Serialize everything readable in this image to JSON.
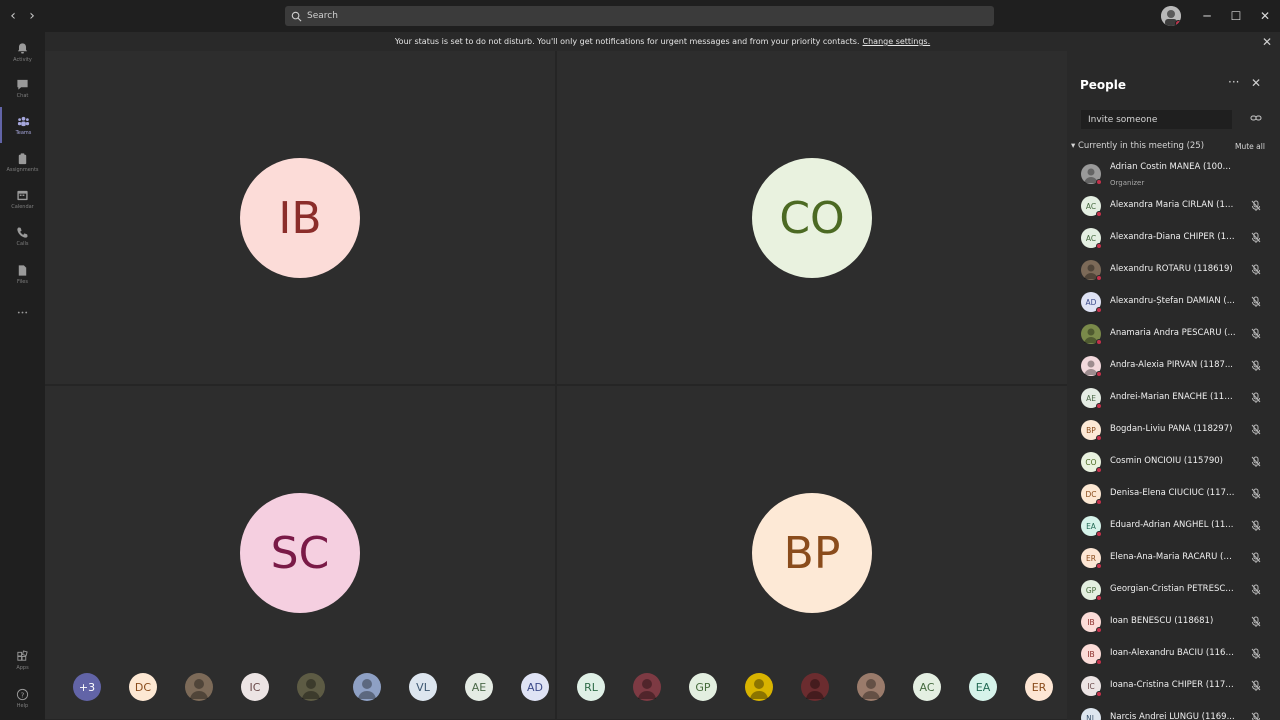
{
  "titlebar": {
    "search_placeholder": "Search",
    "back": "‹",
    "forward": "›",
    "minimize": "─",
    "maximize": "☐",
    "close": "✕"
  },
  "appbar": {
    "items": [
      {
        "label": "Activity",
        "icon": "bell-icon"
      },
      {
        "label": "Chat",
        "icon": "chat-icon"
      },
      {
        "label": "Teams",
        "icon": "teams-icon",
        "active": true
      },
      {
        "label": "Assignments",
        "icon": "assignments-icon"
      },
      {
        "label": "Calendar",
        "icon": "calendar-icon"
      },
      {
        "label": "Calls",
        "icon": "phone-icon"
      },
      {
        "label": "Files",
        "icon": "files-icon"
      },
      {
        "label": "",
        "icon": "more-icon"
      }
    ],
    "bottom": [
      {
        "label": "Apps",
        "icon": "apps-icon"
      },
      {
        "label": "Help",
        "icon": "help-icon"
      }
    ]
  },
  "notification": {
    "text": "Your status is set to do not disturb. You'll only get notifications for urgent messages and from your priority contacts.",
    "link": "Change settings."
  },
  "stage": {
    "tiles": [
      {
        "initials": "IB",
        "bg": "#fcdcd8",
        "fg": "#8b2d2a"
      },
      {
        "initials": "CO",
        "bg": "#e9f2df",
        "fg": "#4c6a23"
      },
      {
        "initials": "SC",
        "bg": "#f5cfe0",
        "fg": "#7a1a47"
      },
      {
        "initials": "BP",
        "bg": "#fde9d6",
        "fg": "#8a4c1c"
      }
    ],
    "roster": [
      {
        "initials": "+3",
        "bg": "#6264a7",
        "fg": "#ffffff"
      },
      {
        "initials": "DC",
        "bg": "#fde8d3",
        "fg": "#8a4c1c"
      },
      {
        "initials": "",
        "bg": "#7c6a58",
        "fg": "#ffffff",
        "photo": true
      },
      {
        "initials": "IC",
        "bg": "#ece4e4",
        "fg": "#6b4a4a"
      },
      {
        "initials": "",
        "bg": "#5d5b44",
        "fg": "#ffffff",
        "photo": true
      },
      {
        "initials": "",
        "bg": "#8ea0c4",
        "fg": "#ffffff",
        "photo": true
      },
      {
        "initials": "VL",
        "bg": "#dde6ef",
        "fg": "#3c5670"
      },
      {
        "initials": "AE",
        "bg": "#e5ece4",
        "fg": "#4d6a4a"
      },
      {
        "initials": "AD",
        "bg": "#dfe3f5",
        "fg": "#3d4b8a"
      },
      {
        "initials": "RL",
        "bg": "#dff0e6",
        "fg": "#2f6b47"
      },
      {
        "initials": "",
        "bg": "#7d3a43",
        "fg": "#ffffff",
        "photo": true
      },
      {
        "initials": "GP",
        "bg": "#e3efe0",
        "fg": "#466b3c"
      },
      {
        "initials": "",
        "bg": "#d8b300",
        "fg": "#ffffff",
        "photo": true
      },
      {
        "initials": "",
        "bg": "#6b2c2f",
        "fg": "#ffffff",
        "photo": true
      },
      {
        "initials": "",
        "bg": "#9a7b6b",
        "fg": "#ffffff",
        "photo": true
      },
      {
        "initials": "AC",
        "bg": "#e4efe2",
        "fg": "#456a3f"
      },
      {
        "initials": "EA",
        "bg": "#d6f3ea",
        "fg": "#236b55"
      },
      {
        "initials": "ER",
        "bg": "#fde6d4",
        "fg": "#8a4c1c"
      }
    ]
  },
  "people": {
    "title": "People",
    "invite_placeholder": "Invite someone",
    "section": "Currently in this meeting (25)",
    "mute_all": "Mute all",
    "participants": [
      {
        "name": "Adrian Costin MANEA (100131)",
        "role": "Organizer",
        "initials": "",
        "bg": "#9a9a9a",
        "fg": "#fff",
        "photo": true
      },
      {
        "name": "Alexandra Maria CIRLAN (11...",
        "initials": "AC",
        "bg": "#e4efe2",
        "fg": "#456a3f"
      },
      {
        "name": "Alexandra-Diana CHIPER (11...",
        "initials": "AC",
        "bg": "#e4efe2",
        "fg": "#456a3f"
      },
      {
        "name": "Alexandru ROTARU (118619)",
        "initials": "",
        "bg": "#7c6a58",
        "fg": "#fff",
        "photo": true
      },
      {
        "name": "Alexandru-Ștefan DAMIAN (...",
        "initials": "AD",
        "bg": "#dfe3f5",
        "fg": "#3d4b8a"
      },
      {
        "name": "Anamaria Andra PESCARU (...",
        "initials": "",
        "bg": "#7a8a4a",
        "fg": "#fff",
        "photo": true
      },
      {
        "name": "Andra-Alexia PÎRVAN (1187...",
        "initials": "",
        "bg": "#f2d8dc",
        "fg": "#fff",
        "photo": true
      },
      {
        "name": "Andrei-Marian ENACHE (116...",
        "initials": "AE",
        "bg": "#e5ece4",
        "fg": "#4d6a4a"
      },
      {
        "name": "Bogdan-Liviu PANA (118297)",
        "initials": "BP",
        "bg": "#fde9d6",
        "fg": "#8a4c1c"
      },
      {
        "name": "Cosmin ONCIOIU (115790)",
        "initials": "CO",
        "bg": "#e9f2df",
        "fg": "#4c6a23"
      },
      {
        "name": "Denisa-Elena CIUCIUC (1175...",
        "initials": "DC",
        "bg": "#fde8d3",
        "fg": "#8a4c1c"
      },
      {
        "name": "Eduard-Adrian ANGHEL (11...",
        "initials": "EA",
        "bg": "#d6f3ea",
        "fg": "#236b55"
      },
      {
        "name": "Elena-Ana-Maria RACARU (1...",
        "initials": "ER",
        "bg": "#fde6d4",
        "fg": "#8a4c1c"
      },
      {
        "name": "Georgian-Cristian PETRESCU...",
        "initials": "GP",
        "bg": "#e3efe0",
        "fg": "#466b3c"
      },
      {
        "name": "Ioan BENESCU (118681)",
        "initials": "IB",
        "bg": "#fcdcd8",
        "fg": "#8b2d2a"
      },
      {
        "name": "Ioan-Alexandru BACIU (1165...",
        "initials": "IB",
        "bg": "#fcdcd8",
        "fg": "#8b2d2a"
      },
      {
        "name": "Ioana-Cristina CHIPER (1171...",
        "initials": "IC",
        "bg": "#ece4e4",
        "fg": "#6b4a4a"
      },
      {
        "name": "Narcis Andrei LUNGU (1169...",
        "initials": "NL",
        "bg": "#dde6ef",
        "fg": "#3c5670"
      }
    ]
  }
}
